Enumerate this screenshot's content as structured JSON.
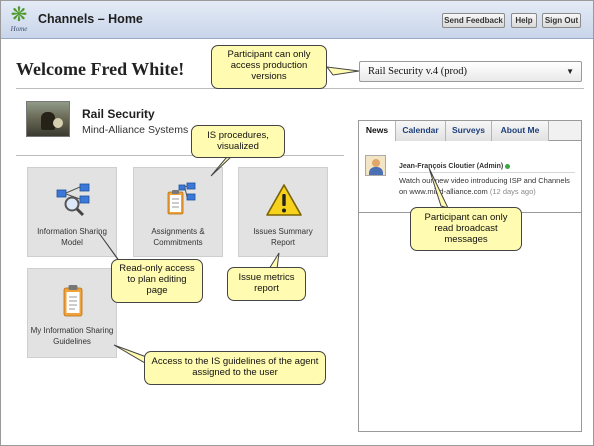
{
  "app": {
    "logo_icon": "snowflake-logo-icon",
    "logo_caption": "Home",
    "title": "Channels – Home"
  },
  "header": {
    "send_feedback": "Send Feedback",
    "help": "Help",
    "sign_out": "Sign Out"
  },
  "welcome": {
    "text": "Welcome Fred White!"
  },
  "plan_selector": {
    "selected": "Rail Security v.4 (prod)"
  },
  "plan": {
    "name": "Rail Security",
    "org": "Mind-Alliance Systems",
    "image_icon": "plan-photo"
  },
  "tiles": [
    {
      "label": "Information Sharing Model",
      "icon": "network-search-icon"
    },
    {
      "label": "Assignments & Commitments",
      "icon": "clipboard-network-icon"
    },
    {
      "label": "Issues Summary Report",
      "icon": "warning-icon"
    },
    {
      "label": "My Information Sharing Guidelines",
      "icon": "clipboard-icon"
    }
  ],
  "tabs": [
    "News",
    "Calendar",
    "Surveys",
    "About Me"
  ],
  "news": {
    "author": "Jean-François Cloutier (Admin)",
    "message": "Watch our new video introducing ISP and Channels on www.mind-alliance.com",
    "when": "(12 days ago)"
  },
  "callouts": {
    "production": "Participant can only access production versions",
    "procedures": "IS procedures, visualized",
    "broadcast": "Participant can only read broadcast messages",
    "readonly": "Read-only access to plan editing page",
    "metrics": "Issue metrics report",
    "guidelines": "Access to the IS guidelines of the agent assigned to the user"
  },
  "colors": {
    "header_bg": "#c9d5ea",
    "tile_bg": "#e2e2e2",
    "callout_bg": "#fffbb0",
    "tab_text": "#1e3f7a",
    "online": "#39a942"
  }
}
